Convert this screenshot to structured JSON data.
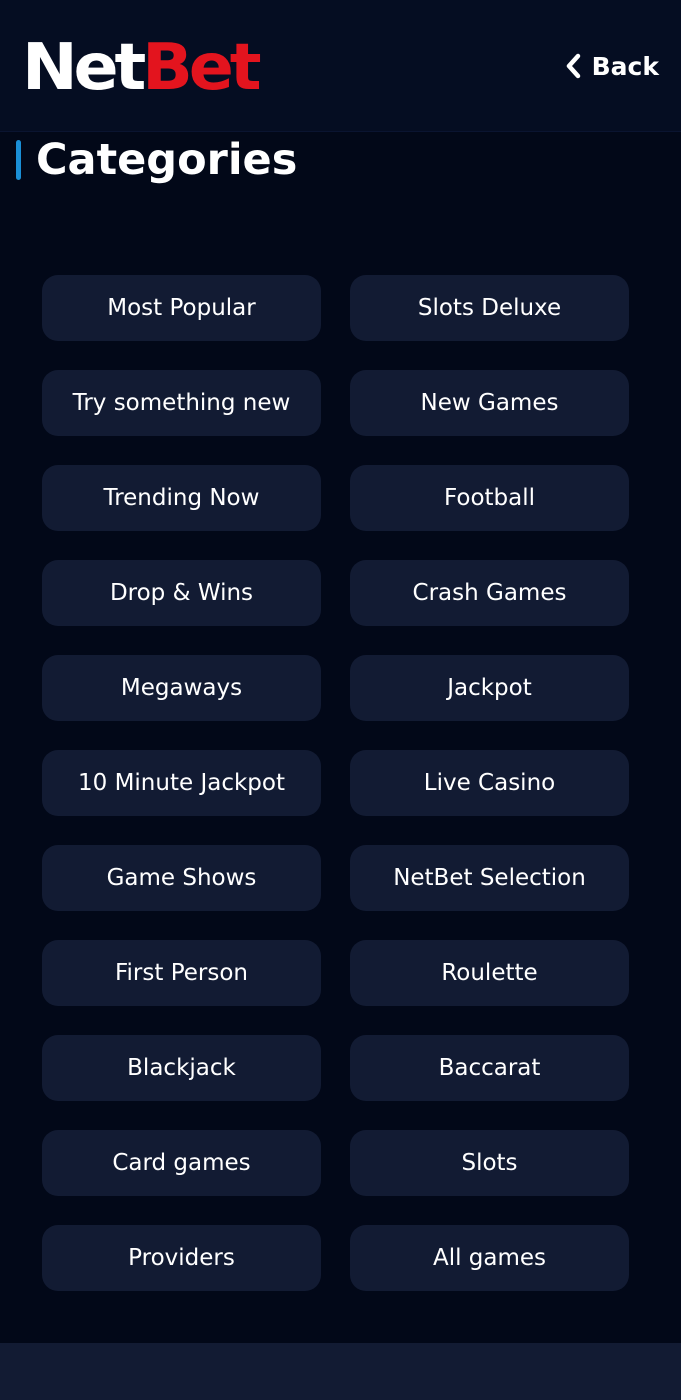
{
  "header": {
    "logo": {
      "part1": "Net",
      "part2": "Bet"
    },
    "back_label": "Back"
  },
  "page": {
    "title": "Categories"
  },
  "colors": {
    "background": "#020818",
    "header_bg": "#050d22",
    "button_bg": "#121b33",
    "brand_red": "#e3141e",
    "accent_blue": "#1a8fd6"
  },
  "icons": {
    "back": "chevron-left-icon"
  },
  "categories": [
    {
      "label": "Most Popular"
    },
    {
      "label": "Slots Deluxe"
    },
    {
      "label": "Try something new"
    },
    {
      "label": "New Games"
    },
    {
      "label": "Trending Now"
    },
    {
      "label": "Football"
    },
    {
      "label": "Drop & Wins"
    },
    {
      "label": "Crash Games"
    },
    {
      "label": "Megaways"
    },
    {
      "label": "Jackpot"
    },
    {
      "label": "10 Minute Jackpot"
    },
    {
      "label": "Live Casino"
    },
    {
      "label": "Game Shows"
    },
    {
      "label": "NetBet Selection"
    },
    {
      "label": "First Person"
    },
    {
      "label": "Roulette"
    },
    {
      "label": "Blackjack"
    },
    {
      "label": "Baccarat"
    },
    {
      "label": "Card games"
    },
    {
      "label": "Slots"
    },
    {
      "label": "Providers"
    },
    {
      "label": "All games"
    }
  ]
}
